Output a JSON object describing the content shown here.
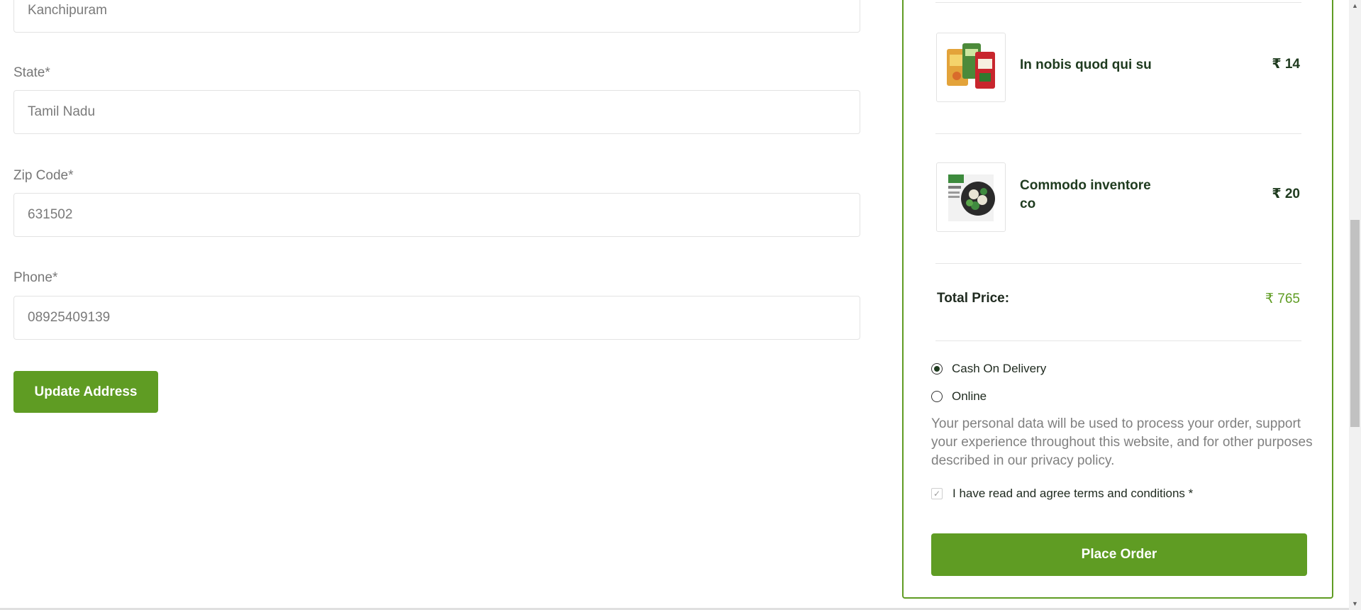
{
  "address_form": {
    "city_value": "Kanchipuram",
    "state_label": "State*",
    "state_value": "Tamil Nadu",
    "zip_label": "Zip Code*",
    "zip_value": "631502",
    "phone_label": "Phone*",
    "phone_value": "08925409139",
    "update_button": "Update Address"
  },
  "order_summary": {
    "items": [
      {
        "name": "In nobis quod qui su",
        "price": "₹ 14"
      },
      {
        "name": "Commodo inventore co",
        "price": "₹ 20"
      }
    ],
    "total_label": "Total Price:",
    "total_value": "₹ 765",
    "payment_options": [
      {
        "label": "Cash On Delivery",
        "selected": true
      },
      {
        "label": "Online",
        "selected": false
      }
    ],
    "privacy_text": "Your personal data will be used to process your order, support your experience throughout this website, and for other purposes described in our privacy policy.",
    "terms_label": "I have read and agree terms and conditions *",
    "terms_checked": true,
    "place_order_button": "Place Order"
  },
  "colors": {
    "accent": "#5f9c23",
    "text_dark": "#1f3b1f",
    "muted": "#808080"
  }
}
